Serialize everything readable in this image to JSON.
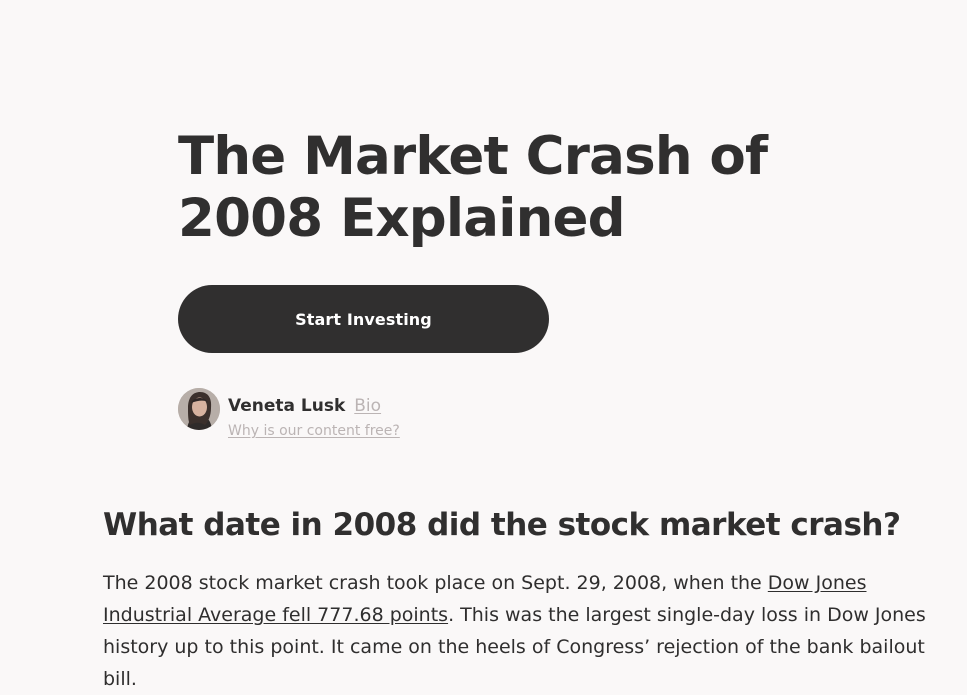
{
  "article": {
    "title": "The Market Crash of 2008 Explained",
    "cta_label": "Start Investing",
    "author": {
      "name": "Veneta Lusk",
      "bio_link": "Bio",
      "content_free_link": "Why is our content free?"
    },
    "section": {
      "heading": "What date in 2008 did the stock market crash?",
      "paragraph": {
        "prefix": "The 2008 stock market crash took place on Sept. 29, 2008, when the ",
        "link": "Dow Jones Industrial Average fell 777.68 points",
        "suffix": ". This was the largest single-day loss in Dow Jones history up to this point. It came on the heels of Congress’ rejection of the bank bailout bill."
      }
    }
  },
  "colors": {
    "background": "#faf8f8",
    "text": "#302f2f",
    "muted_link": "#bbb4b4",
    "button": "#302f2f",
    "button_text": "#ffffff"
  },
  "icons": {
    "avatar": "author-photo"
  }
}
